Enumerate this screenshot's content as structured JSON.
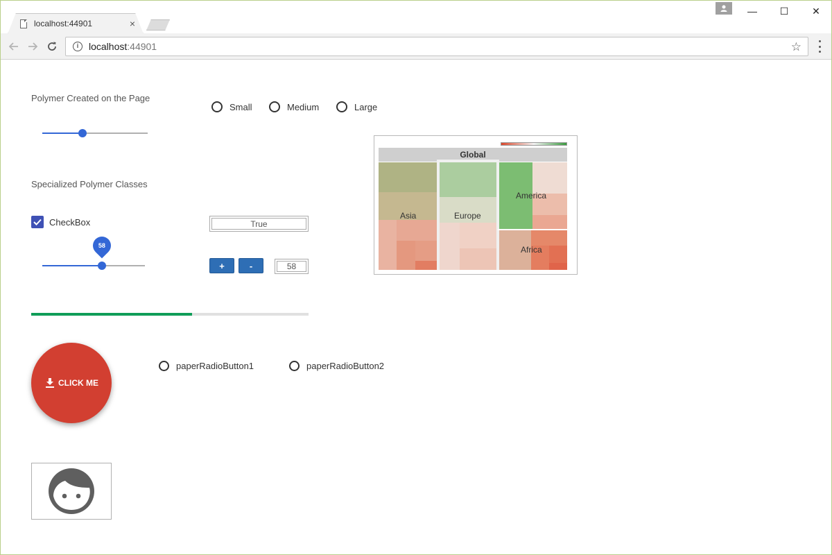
{
  "browser": {
    "tab_title": "localhost:44901",
    "tab_close": "×",
    "url_host": "localhost",
    "url_port": ":44901",
    "star": "☆",
    "win_minimize": "—",
    "win_maximize": "☐",
    "win_close": "✕"
  },
  "page": {
    "heading_created": "Polymer Created on the Page",
    "heading_specialized": "Specialized Polymer Classes",
    "size_options": [
      "Small",
      "Medium",
      "Large"
    ],
    "slider1_fraction": 0.38,
    "checkbox_label": "CheckBox",
    "checkbox_checked": true,
    "textbox_value": "True",
    "slider2_value": "58",
    "slider2_fraction": 0.58,
    "plus_label": "+",
    "minus_label": "-",
    "number_value": "58",
    "progress_fraction": 0.58,
    "fab_label": "CLICK ME",
    "paper_radio_1": "paperRadioButton1",
    "paper_radio_2": "paperRadioButton2"
  },
  "treemap": {
    "title": "Global",
    "regions": [
      "Asia",
      "Europe",
      "America",
      "Africa"
    ],
    "legend_colors": [
      "#d9472b",
      "#f3f3f3",
      "#3a9a3f"
    ]
  },
  "icons": {
    "page": "page-icon",
    "back": "arrow-left-icon",
    "forward": "arrow-right-icon",
    "reload": "reload-icon",
    "info": "info-icon",
    "star": "star-icon",
    "menu": "more-vert-icon",
    "profile": "profile-icon",
    "check": "check-icon",
    "download": "download-icon",
    "face": "face-icon"
  }
}
